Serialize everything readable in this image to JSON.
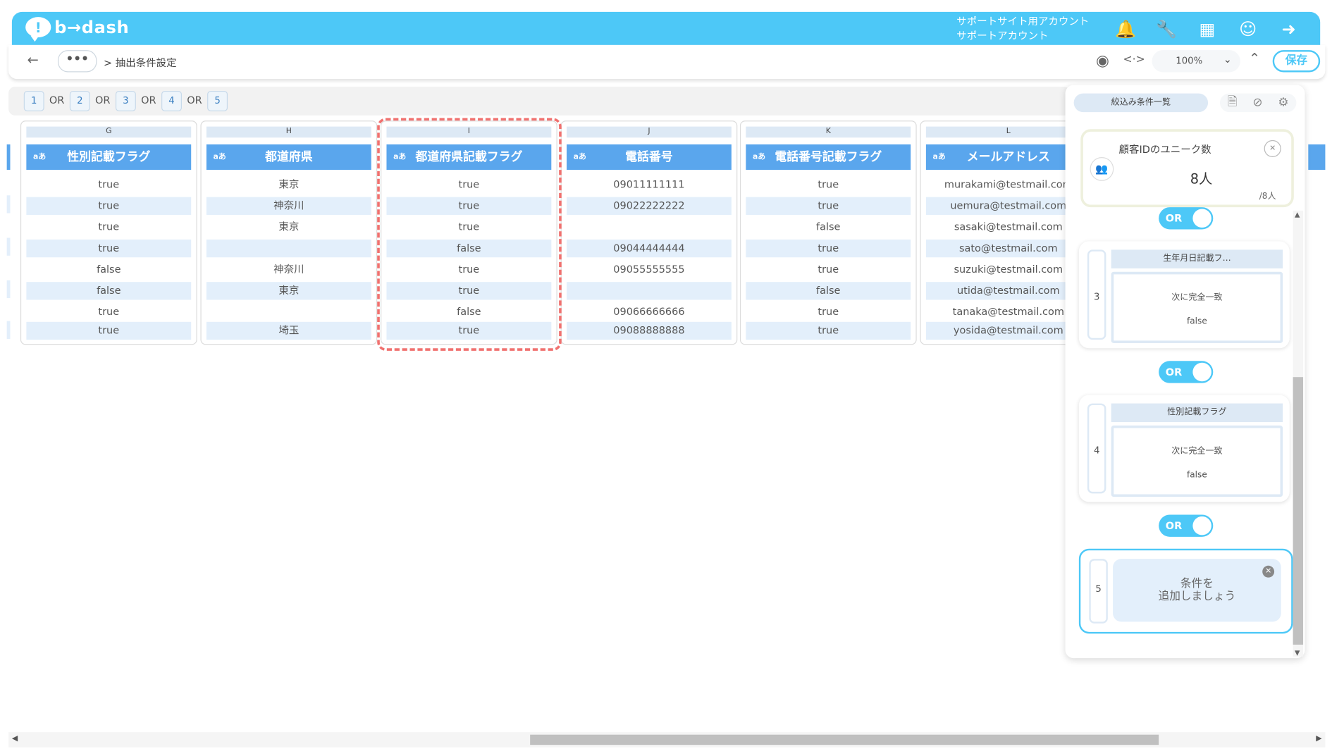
{
  "header": {
    "logo_text": "b→dash",
    "account_line1": "サポートサイト用アカウント",
    "account_line2": "サポートアカウント",
    "icons": [
      "bell-icon",
      "wrench-icon",
      "grid-icon",
      "chat-icon",
      "logout-icon"
    ]
  },
  "subbar": {
    "back": "←",
    "dots": "•••",
    "breadcrumb": "> 抽出条件設定",
    "zoom": "100%",
    "save": "保存"
  },
  "orbar": {
    "chips": [
      "1",
      "2",
      "3",
      "4",
      "5"
    ],
    "or_label": "OR"
  },
  "columns": [
    {
      "letter": "G",
      "title": "性別記載フラグ",
      "type": "aあ",
      "cells": [
        "true",
        "true",
        "true",
        "true",
        "false",
        "false",
        "true",
        "true"
      ]
    },
    {
      "letter": "H",
      "title": "都道府県",
      "type": "aあ",
      "cells": [
        "東京",
        "神奈川",
        "東京",
        "",
        "神奈川",
        "東京",
        "",
        "埼玉"
      ]
    },
    {
      "letter": "I",
      "title": "都道府県記載フラグ",
      "type": "aあ",
      "cells": [
        "true",
        "true",
        "true",
        "false",
        "true",
        "true",
        "false",
        "true"
      ]
    },
    {
      "letter": "J",
      "title": "電話番号",
      "type": "aあ",
      "cells": [
        "09011111111",
        "09022222222",
        "",
        "09044444444",
        "09055555555",
        "",
        "09066666666",
        "09088888888"
      ]
    },
    {
      "letter": "K",
      "title": "電話番号記載フラグ",
      "type": "aあ",
      "cells": [
        "true",
        "true",
        "false",
        "true",
        "true",
        "false",
        "true",
        "true"
      ]
    },
    {
      "letter": "L",
      "title": "メールアドレス",
      "type": "aあ",
      "cells": [
        "murakami@testmail.com",
        "uemura@testmail.com",
        "sasaki@testmail.com",
        "sato@testmail.com",
        "suzuki@testmail.com",
        "utida@testmail.com",
        "tanaka@testmail.com",
        "yosida@testmail.com"
      ]
    }
  ],
  "panel": {
    "tab_label": "絞込み条件一覧",
    "unique_title": "顧客IDのユニーク数",
    "unique_value": "8人",
    "unique_total": "/8人",
    "or_label": "OR",
    "conditions": [
      {
        "num": "3",
        "title": "生年月日記載フ…",
        "op": "次に完全一致",
        "value": "false"
      },
      {
        "num": "4",
        "title": "性別記載フラグ",
        "op": "次に完全一致",
        "value": "false"
      }
    ],
    "add": {
      "num": "5",
      "text_line1": "条件を",
      "text_line2": "追加しましょう"
    }
  }
}
